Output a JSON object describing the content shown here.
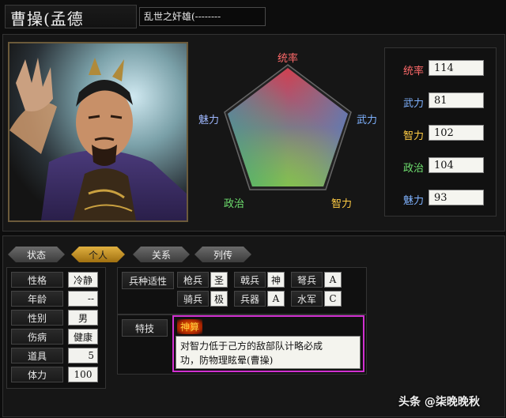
{
  "header": {
    "name": "曹操(孟德",
    "title": "乱世之奸雄(--------"
  },
  "radar": {
    "labels": {
      "top": "统率",
      "right": "武力",
      "bottom_right": "智力",
      "bottom_left": "政治",
      "left": "魅力"
    },
    "colors": {
      "top": "#ff6a6a",
      "right": "#7fb2ff",
      "bottom_right": "#ffcc44",
      "bottom_left": "#6fe06f",
      "left": "#9fb8ff"
    }
  },
  "stats": [
    {
      "label": "统率",
      "value": "114",
      "color": "#ff6a6a"
    },
    {
      "label": "武力",
      "value": "81",
      "color": "#7fb2ff"
    },
    {
      "label": "智力",
      "value": "102",
      "color": "#ffcc44"
    },
    {
      "label": "政治",
      "value": "104",
      "color": "#6fe06f"
    },
    {
      "label": "魅力",
      "value": "93",
      "color": "#7fb2ff"
    }
  ],
  "tabs": [
    "状态",
    "个人",
    "关系",
    "列传"
  ],
  "personal": [
    {
      "label": "性格",
      "value": "冷静"
    },
    {
      "label": "年龄",
      "value": "--"
    },
    {
      "label": "性别",
      "value": "男"
    },
    {
      "label": "伤病",
      "value": "健康"
    },
    {
      "label": "道具",
      "value": "5"
    },
    {
      "label": "体力",
      "value": "100"
    }
  ],
  "aptitude": {
    "title": "兵种适性",
    "rows": [
      [
        {
          "label": "枪兵",
          "value": "圣"
        },
        {
          "label": "戟兵",
          "value": "神"
        },
        {
          "label": "弩兵",
          "value": "A"
        }
      ],
      [
        {
          "label": "骑兵",
          "value": "极"
        },
        {
          "label": "兵器",
          "value": "A"
        },
        {
          "label": "水军",
          "value": "C"
        }
      ]
    ]
  },
  "skill": {
    "title": "特技",
    "name": "神算",
    "desc1": "对智力低于己方的敌部队计略必成",
    "desc2": "功，防物理眩晕(曹操)"
  },
  "watermark": "头条 @柒晚晚秋"
}
